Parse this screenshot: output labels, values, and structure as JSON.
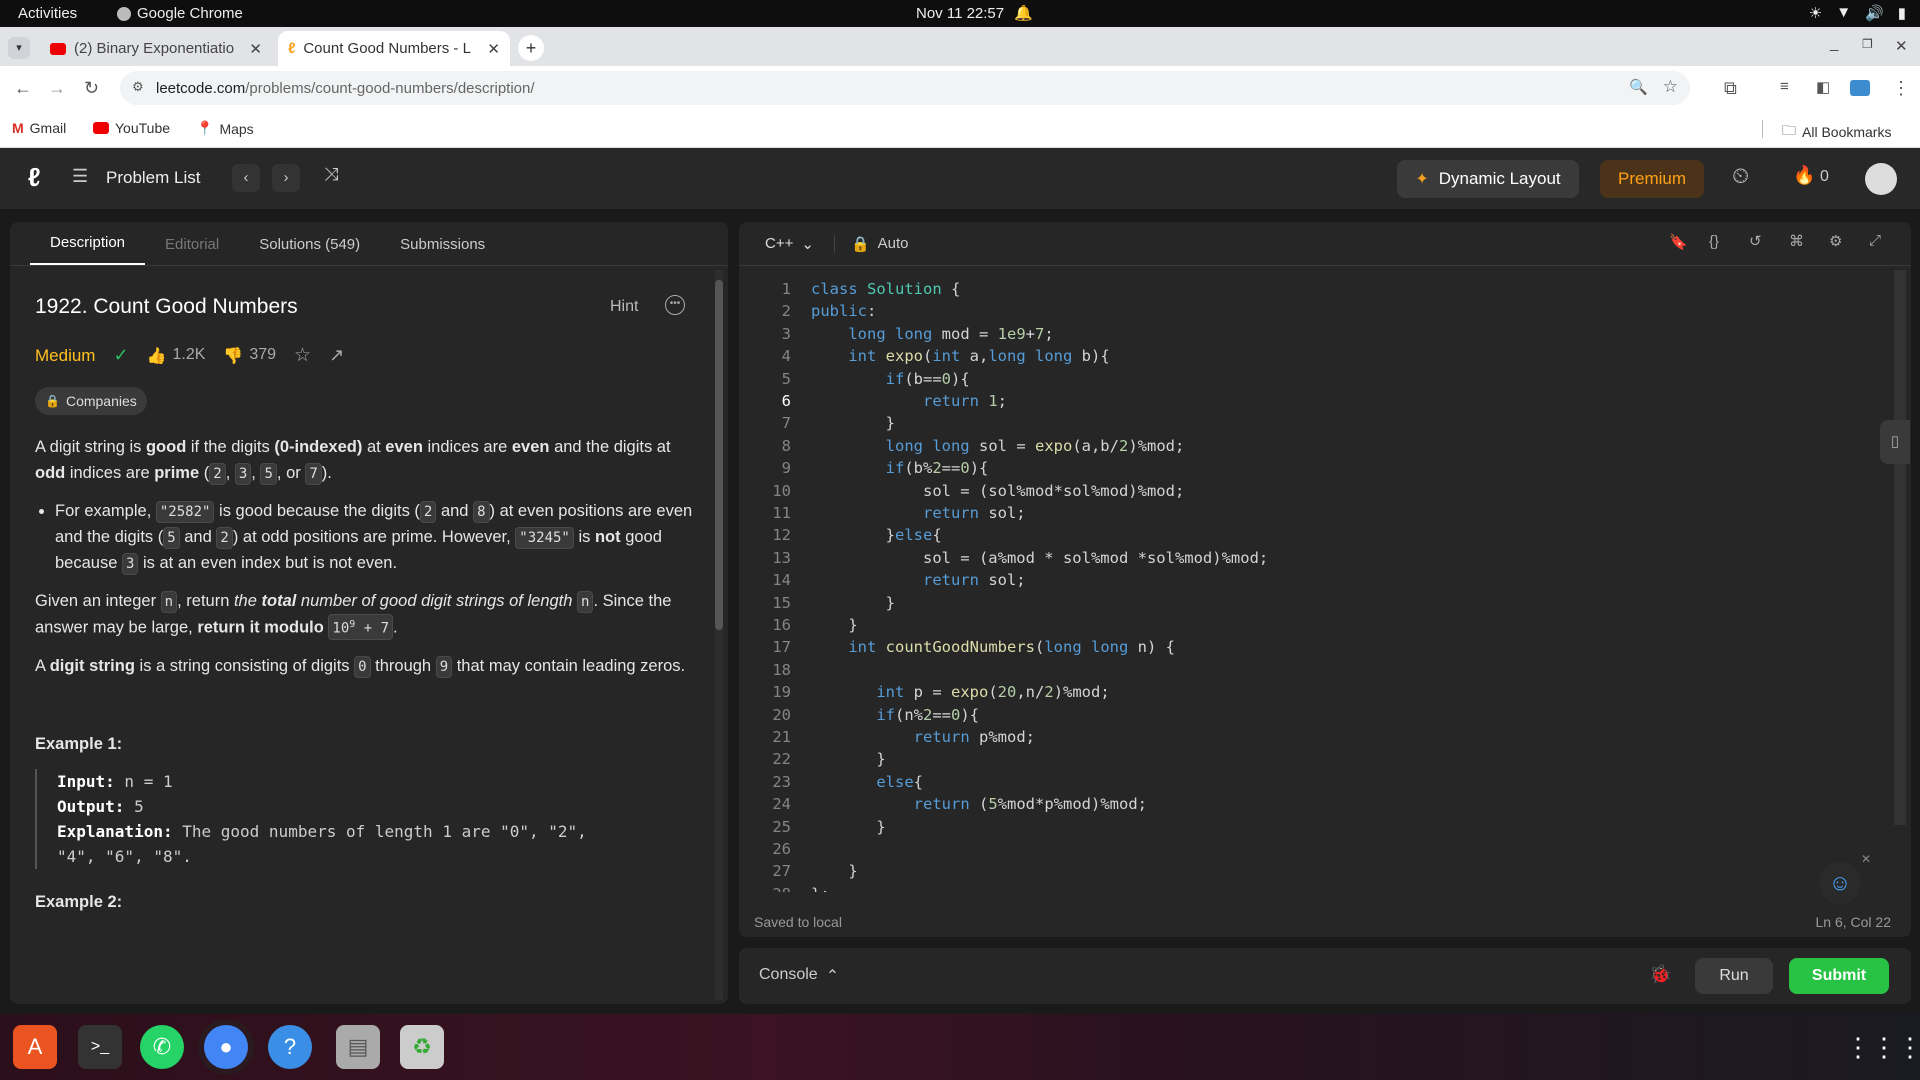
{
  "os": {
    "activities": "Activities",
    "app": "Google Chrome",
    "datetime": "Nov 11  22:57"
  },
  "browser": {
    "tabs": [
      {
        "title": "(2) Binary Exponentiatio"
      },
      {
        "title": "Count Good Numbers - L"
      }
    ],
    "url_host": "leetcode.com",
    "url_path": "/problems/count-good-numbers/description/",
    "bookmarks": [
      "Gmail",
      "YouTube",
      "Maps"
    ],
    "all_bookmarks": "All Bookmarks"
  },
  "header": {
    "problem_list": "Problem List",
    "dynamic_layout": "Dynamic Layout",
    "premium": "Premium",
    "streak": "0"
  },
  "left": {
    "tabs": [
      "Description",
      "Editorial",
      "Solutions (549)",
      "Submissions"
    ],
    "title": "1922. Count Good Numbers",
    "hint": "Hint",
    "difficulty": "Medium",
    "likes": "1.2K",
    "dislikes": "379",
    "companies": "Companies",
    "p1a": "A digit string is ",
    "p1b": "good",
    "p1c": " if the digits ",
    "p1d": "(0-indexed)",
    "p1e": " at ",
    "p1f": "even",
    "p1g": " indices are ",
    "p1h": "even",
    "p1i": " and the digits at ",
    "p1j": "odd",
    "p1k": " indices are ",
    "p1l": "prime",
    "p1m": " (",
    "d2": "2",
    "d3": "3",
    "d5": "5",
    "d7": "7",
    "p1n": ", or ",
    "p1o": ").",
    "b1": "For example, ",
    "s2582": "\"2582\"",
    "b2": " is good because the digits (",
    "b3": " and ",
    "d8": "8",
    "b4": ") at even positions are even and the digits (",
    "b5": ") at odd positions are prime. However, ",
    "s3245": "\"3245\"",
    "b6": " is ",
    "b7": "not",
    "b8": " good because ",
    "b9": " is at an even index but is not even.",
    "g1": "Given an integer ",
    "n": "n",
    "g2": ", return ",
    "g3": "the ",
    "g4": "total",
    "g5": " number of good digit strings of length ",
    "g6": ". Since the answer may be large, ",
    "g7": "return it modulo ",
    "mod": "10",
    "exp": "9",
    "mod2": " + 7",
    "g8": ".",
    "h1": "A ",
    "h2": "digit string",
    "h3": " is a string consisting of digits ",
    "d0": "0",
    "h4": " through ",
    "d9": "9",
    "h5": " that may contain leading zeros.",
    "ex1": "Example 1:",
    "in_l": "Input:",
    "in_v": " n = 1",
    "out_l": "Output:",
    "out_v": " 5",
    "exp_l": "Explanation:",
    "exp_v": " The good numbers of length 1 are \"0\", \"2\",",
    "exp_v2": "\"4\", \"6\", \"8\".",
    "ex2": "Example 2:"
  },
  "editor": {
    "lang": "C++",
    "mode": "Auto",
    "saved": "Saved to local",
    "cursor": "Ln 6, Col 22"
  },
  "console": {
    "label": "Console",
    "run": "Run",
    "submit": "Submit"
  }
}
